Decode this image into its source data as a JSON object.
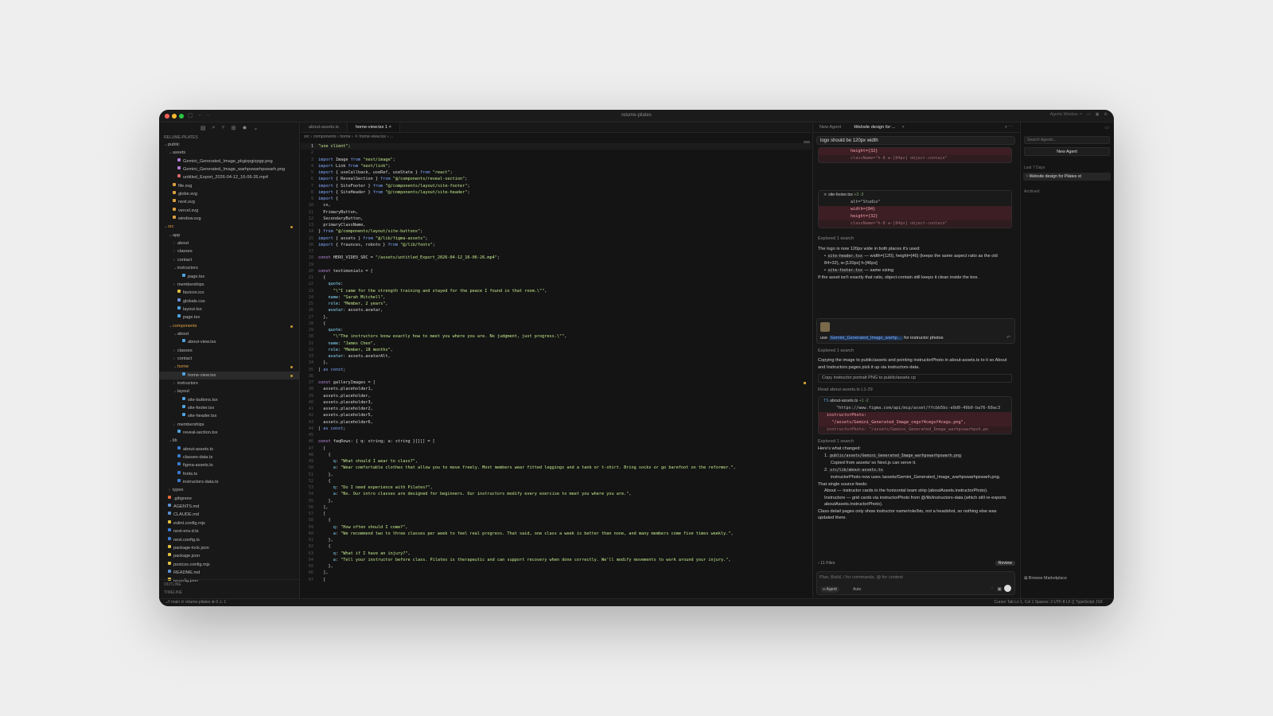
{
  "window": {
    "title": "relume-pilates",
    "agents_window": "Agents Window ↗"
  },
  "sidebar": {
    "header": "RELUME-PILATES",
    "outline": "OUTLINE",
    "timeline": "TIMELINE",
    "tree": [
      {
        "label": "public",
        "d": 0,
        "t": "f"
      },
      {
        "label": "assets",
        "d": 1,
        "t": "f"
      },
      {
        "label": "Gemini_Generated_Image_pkgizpgizpgp.png",
        "d": 2,
        "t": "img"
      },
      {
        "label": "Gemini_Generated_Image_warhpswarhpswarh.png",
        "d": 2,
        "t": "img"
      },
      {
        "label": "untitled_Export_2026-04-12_16-06-26.mp4",
        "d": 2,
        "t": "vid"
      },
      {
        "label": "file.svg",
        "d": 1,
        "t": "svg"
      },
      {
        "label": "globe.svg",
        "d": 1,
        "t": "svg"
      },
      {
        "label": "next.svg",
        "d": 1,
        "t": "svg"
      },
      {
        "label": "vercel.svg",
        "d": 1,
        "t": "svg"
      },
      {
        "label": "window.svg",
        "d": 1,
        "t": "svg"
      },
      {
        "label": "src",
        "d": 0,
        "t": "f",
        "m": 1,
        "c": "#e0a040"
      },
      {
        "label": "app",
        "d": 1,
        "t": "f"
      },
      {
        "label": "about",
        "d": 2,
        "t": "fc"
      },
      {
        "label": "classes",
        "d": 2,
        "t": "fc"
      },
      {
        "label": "contact",
        "d": 2,
        "t": "fc"
      },
      {
        "label": "instructors",
        "d": 2,
        "t": "f"
      },
      {
        "label": "page.tsx",
        "d": 3,
        "t": "tsx"
      },
      {
        "label": "memberships",
        "d": 2,
        "t": "fc"
      },
      {
        "label": "favicon.ico",
        "d": 2,
        "t": "ico"
      },
      {
        "label": "globals.css",
        "d": 2,
        "t": "css"
      },
      {
        "label": "layout.tsx",
        "d": 2,
        "t": "tsx"
      },
      {
        "label": "page.tsx",
        "d": 2,
        "t": "tsx"
      },
      {
        "label": "components",
        "d": 1,
        "t": "f",
        "m": 1,
        "c": "#e0a040"
      },
      {
        "label": "about",
        "d": 2,
        "t": "f"
      },
      {
        "label": "about-view.tsx",
        "d": 3,
        "t": "tsx"
      },
      {
        "label": "classes",
        "d": 2,
        "t": "fc"
      },
      {
        "label": "contact",
        "d": 2,
        "t": "fc"
      },
      {
        "label": "home",
        "d": 2,
        "t": "f",
        "m": 1,
        "c": "#e0a040"
      },
      {
        "label": "home-view.tsx",
        "d": 3,
        "t": "tsx",
        "a": 1,
        "m": 1
      },
      {
        "label": "instructors",
        "d": 2,
        "t": "fc"
      },
      {
        "label": "layout",
        "d": 2,
        "t": "f"
      },
      {
        "label": "site-buttons.tsx",
        "d": 3,
        "t": "tsx"
      },
      {
        "label": "site-footer.tsx",
        "d": 3,
        "t": "tsx"
      },
      {
        "label": "site-header.tsx",
        "d": 3,
        "t": "tsx"
      },
      {
        "label": "memberships",
        "d": 2,
        "t": "fc"
      },
      {
        "label": "reveal-section.tsx",
        "d": 2,
        "t": "tsx"
      },
      {
        "label": "lib",
        "d": 1,
        "t": "f"
      },
      {
        "label": "about-assets.ts",
        "d": 2,
        "t": "ts"
      },
      {
        "label": "classes-data.ts",
        "d": 2,
        "t": "ts"
      },
      {
        "label": "figma-assets.ts",
        "d": 2,
        "t": "ts"
      },
      {
        "label": "fonts.ts",
        "d": 2,
        "t": "ts"
      },
      {
        "label": "instructors-data.ts",
        "d": 2,
        "t": "ts"
      },
      {
        "label": "types",
        "d": 1,
        "t": "fc"
      },
      {
        "label": ".gitignore",
        "d": 0,
        "t": "git"
      },
      {
        "label": "AGENTS.md",
        "d": 0,
        "t": "md"
      },
      {
        "label": "CLAUDE.md",
        "d": 0,
        "t": "md"
      },
      {
        "label": "eslint.config.mjs",
        "d": 0,
        "t": "js"
      },
      {
        "label": "next-env.d.ts",
        "d": 0,
        "t": "ts"
      },
      {
        "label": "next.config.ts",
        "d": 0,
        "t": "ts"
      },
      {
        "label": "package-lock.json",
        "d": 0,
        "t": "json"
      },
      {
        "label": "package.json",
        "d": 0,
        "t": "json"
      },
      {
        "label": "postcss.config.mjs",
        "d": 0,
        "t": "js"
      },
      {
        "label": "README.md",
        "d": 0,
        "t": "md"
      },
      {
        "label": "tsconfig.json",
        "d": 0,
        "t": "json"
      }
    ]
  },
  "editor": {
    "tabs": [
      {
        "label": "about-assets.ts",
        "on": 0
      },
      {
        "label": "home-view.tsx 1  ×",
        "on": 1
      }
    ],
    "breadcrumb": "src › components › home › ⚛ home-view.tsx › ..."
  },
  "code": [
    [
      [
        "s",
        "\"use client\";"
      ]
    ],
    [],
    [
      [
        "k",
        "import "
      ],
      [
        "v",
        "Image "
      ],
      [
        "k",
        "from "
      ],
      [
        "s",
        "\"next/image\""
      ],
      [
        "v",
        ";"
      ]
    ],
    [
      [
        "k",
        "import "
      ],
      [
        "v",
        "Link "
      ],
      [
        "k",
        "from "
      ],
      [
        "s",
        "\"next/link\""
      ],
      [
        "v",
        ";"
      ]
    ],
    [
      [
        "k",
        "import "
      ],
      [
        "v",
        "{ useCallback, useRef, useState } "
      ],
      [
        "k",
        "from "
      ],
      [
        "s",
        "\"react\""
      ],
      [
        "v",
        ";"
      ]
    ],
    [
      [
        "k",
        "import "
      ],
      [
        "v",
        "{ RevealSection } "
      ],
      [
        "k",
        "from "
      ],
      [
        "s",
        "\"@/components/reveal-section\""
      ],
      [
        "v",
        ";"
      ]
    ],
    [
      [
        "k",
        "import "
      ],
      [
        "v",
        "{ SiteFooter } "
      ],
      [
        "k",
        "from "
      ],
      [
        "s",
        "\"@/components/layout/site-footer\""
      ],
      [
        "v",
        ";"
      ]
    ],
    [
      [
        "k",
        "import "
      ],
      [
        "v",
        "{ SiteHeader } "
      ],
      [
        "k",
        "from "
      ],
      [
        "s",
        "\"@/components/layout/site-header\""
      ],
      [
        "v",
        ";"
      ]
    ],
    [
      [
        "k",
        "import "
      ],
      [
        "v",
        "{"
      ]
    ],
    [
      [
        "v",
        "  cx,"
      ]
    ],
    [
      [
        "v",
        "  PrimaryButton,"
      ]
    ],
    [
      [
        "v",
        "  SecondaryButton,"
      ]
    ],
    [
      [
        "v",
        "  primaryClassName,"
      ]
    ],
    [
      [
        "v",
        "} "
      ],
      [
        "k",
        "from "
      ],
      [
        "s",
        "\"@/components/layout/site-buttons\""
      ],
      [
        "v",
        ";"
      ]
    ],
    [
      [
        "k",
        "import "
      ],
      [
        "v",
        "{ assets } "
      ],
      [
        "k",
        "from "
      ],
      [
        "s",
        "\"@/lib/figma-assets\""
      ],
      [
        "v",
        ";"
      ]
    ],
    [
      [
        "k",
        "import "
      ],
      [
        "v",
        "{ fraunces, roboto } "
      ],
      [
        "k",
        "from "
      ],
      [
        "s",
        "\"@/lib/fonts\""
      ],
      [
        "v",
        ";"
      ]
    ],
    [],
    [
      [
        "p",
        "const "
      ],
      [
        "v",
        "HERO_VIDEO_SRC = "
      ],
      [
        "s",
        "\"/assets/untitled_Export_2026-04-12_16-06-26.mp4\""
      ],
      [
        "v",
        ";"
      ]
    ],
    [],
    [
      [
        "p",
        "const "
      ],
      [
        "v",
        "testimonials = ["
      ]
    ],
    [
      [
        "v",
        "  {"
      ]
    ],
    [
      [
        "c",
        "    quote"
      ],
      [
        "v",
        ":"
      ]
    ],
    [
      [
        "s",
        "      \"\\\"I came for the strength training and stayed for the peace I found in that room.\\\"\""
      ],
      [
        "v",
        ","
      ]
    ],
    [
      [
        "c",
        "    name"
      ],
      [
        "v",
        ": "
      ],
      [
        "s",
        "\"Sarah Mitchell\""
      ],
      [
        "v",
        ","
      ]
    ],
    [
      [
        "c",
        "    role"
      ],
      [
        "v",
        ": "
      ],
      [
        "s",
        "\"Member, 2 years\""
      ],
      [
        "v",
        ","
      ]
    ],
    [
      [
        "c",
        "    avatar"
      ],
      [
        "v",
        ": assets.avatar,"
      ]
    ],
    [
      [
        "v",
        "  },"
      ]
    ],
    [
      [
        "v",
        "  {"
      ]
    ],
    [
      [
        "c",
        "    quote"
      ],
      [
        "v",
        ":"
      ]
    ],
    [
      [
        "s",
        "      \"\\\"The instructors know exactly how to meet you where you are. No judgment, just progress.\\\"\""
      ],
      [
        "v",
        ","
      ]
    ],
    [
      [
        "c",
        "    name"
      ],
      [
        "v",
        ": "
      ],
      [
        "s",
        "\"James Chen\""
      ],
      [
        "v",
        ","
      ]
    ],
    [
      [
        "c",
        "    role"
      ],
      [
        "v",
        ": "
      ],
      [
        "s",
        "\"Member, 18 months\""
      ],
      [
        "v",
        ","
      ]
    ],
    [
      [
        "c",
        "    avatar"
      ],
      [
        "v",
        ": assets.avatarAlt,"
      ]
    ],
    [
      [
        "v",
        "  },"
      ]
    ],
    [
      [
        "v",
        "] "
      ],
      [
        "k",
        "as const"
      ],
      [
        "v",
        ";"
      ]
    ],
    [],
    [
      [
        "p",
        "const "
      ],
      [
        "v",
        "galleryImages = ["
      ]
    ],
    [
      [
        "v",
        "  assets.placeholder1,"
      ]
    ],
    [
      [
        "v",
        "  assets.placeholder,"
      ]
    ],
    [
      [
        "v",
        "  assets.placeholder3,"
      ]
    ],
    [
      [
        "v",
        "  assets.placeholder2,"
      ]
    ],
    [
      [
        "v",
        "  assets.placeholder5,"
      ]
    ],
    [
      [
        "v",
        "  assets.placeholder6,"
      ]
    ],
    [
      [
        "v",
        "] "
      ],
      [
        "k",
        "as const"
      ],
      [
        "v",
        ";"
      ]
    ],
    [],
    [
      [
        "p",
        "const "
      ],
      [
        "v",
        "faqRows: { q: string; a: string }[][] = ["
      ]
    ],
    [
      [
        "v",
        "  ["
      ]
    ],
    [
      [
        "v",
        "    {"
      ]
    ],
    [
      [
        "c",
        "      q"
      ],
      [
        "v",
        ": "
      ],
      [
        "s",
        "\"What should I wear to class?\""
      ],
      [
        "v",
        ","
      ]
    ],
    [
      [
        "c",
        "      a"
      ],
      [
        "v",
        ": "
      ],
      [
        "s",
        "\"Wear comfortable clothes that allow you to move freely. Most members wear fitted leggings and a tank or t-shirt. Bring socks or go barefoot on the reformer.\""
      ],
      [
        "v",
        ","
      ]
    ],
    [
      [
        "v",
        "    },"
      ]
    ],
    [
      [
        "v",
        "    {"
      ]
    ],
    [
      [
        "c",
        "      q"
      ],
      [
        "v",
        ": "
      ],
      [
        "s",
        "\"Do I need experience with Pilates?\""
      ],
      [
        "v",
        ","
      ]
    ],
    [
      [
        "c",
        "      a"
      ],
      [
        "v",
        ": "
      ],
      [
        "s",
        "\"No. Our intro classes are designed for beginners. Our instructors modify every exercise to meet you where you are.\""
      ],
      [
        "v",
        ","
      ]
    ],
    [
      [
        "v",
        "    },"
      ]
    ],
    [
      [
        "v",
        "  ],"
      ]
    ],
    [
      [
        "v",
        "  ["
      ]
    ],
    [
      [
        "v",
        "    {"
      ]
    ],
    [
      [
        "c",
        "      q"
      ],
      [
        "v",
        ": "
      ],
      [
        "s",
        "\"How often should I come?\""
      ],
      [
        "v",
        ","
      ]
    ],
    [
      [
        "c",
        "      a"
      ],
      [
        "v",
        ": "
      ],
      [
        "s",
        "\"We recommend two to three classes per week to feel real progress. That said, one class a week is better than none, and many members come five times weekly.\""
      ],
      [
        "v",
        ","
      ]
    ],
    [
      [
        "v",
        "    },"
      ]
    ],
    [
      [
        "v",
        "    {"
      ]
    ],
    [
      [
        "c",
        "      q"
      ],
      [
        "v",
        ": "
      ],
      [
        "s",
        "\"What if I have an injury?\""
      ],
      [
        "v",
        ","
      ]
    ],
    [
      [
        "c",
        "      a"
      ],
      [
        "v",
        ": "
      ],
      [
        "s",
        "\"Tell your instructor before class. Pilates is therapeutic and can support recovery when done correctly. We'll modify movements to work around your injury.\""
      ],
      [
        "v",
        ","
      ]
    ],
    [
      [
        "v",
        "    },"
      ]
    ],
    [
      [
        "v",
        "  ],"
      ]
    ],
    [
      [
        "v",
        "  ["
      ]
    ]
  ],
  "agent": {
    "tabs": [
      "New Agent",
      "Website design for ..."
    ],
    "query": "logo should be 120px width",
    "diff1": [
      "height={32}",
      "className=\"h-8 w-[84px] object-contain\""
    ],
    "footer_file": "site-footer.tsx",
    "footer_delta": "+3 -3",
    "diff2": [
      "alt=\"Studio\"",
      "width={84}",
      "height={32}",
      "className=\"h-8 w-[84px] object-contain\""
    ],
    "explored": "Explored 1 search",
    "msg1": "The logo is now 120px wide in both places it's used:",
    "msg1_b1a": "site-header.tsx",
    "msg1_b1b": " — width={120}, height={46} (keeps the same aspect ratio as the old 84×32), w-[120px] h-[46px]",
    "msg1_b2a": "site-footer.tsx",
    "msg1_b2b": " — same sizing",
    "msg1_end": "If the asset isn't exactly that ratio, object-contain still keeps it clean inside the box.",
    "user_use": "use",
    "user_chip": "Gemini_Generated_Image_warhp...",
    "user_rest": "for instructor photos",
    "msg2": "Copying the image to public/assets and pointing instructorPhoto in about-assets.ts to it so About and Instructors pages pick it up via instructors-data.",
    "cmd": "Copy instructor portrait PNG to public/assets  cp",
    "read": "Read about-assets.ts L1-29",
    "assets_file": "about-assets.ts",
    "assets_delta": "+1 -2",
    "diff3": [
      "\"https://www.figma.com/api/mcp/asset/ffcbb5bc-e9d0-49b0-ba76-60ac3",
      "instructorPhoto:",
      "  \"/assets/Gemini_Generated_Image_cegsf4cegsf4cegs.png\",",
      "instructorPhoto: \"/assets/Gemini_Generated_Image_warhpswarhpsh.pn"
    ],
    "changed": "Here's what changed:",
    "c1": "public/assets/Gemini_Generated_Image_warhpswarhpswarh.png",
    "c1s": "Copied from assets/ so Next.js can serve it.",
    "c2": "src/lib/about-assets.ts",
    "c2s": "instructorPhoto now uses /assets/Gemini_Generated_Image_warhpswarhpswarh.png.",
    "feeds": "That single source feeds:",
    "f1": "About — instructor cards in the horizontal team strip (aboutAssets.instructorPhoto).",
    "f2": "Instructors — grid cards via instructorPhoto from @/lib/instructors-data (which still re-exports aboutAssets.instructorPhoto).",
    "closing": "Class detail pages only show instructor name/role/bio, not a headshot, so nothing else was updated there.",
    "files": "› 11 Files",
    "review": "Review",
    "placeholder": "Plan, Build, / for commands, @ for context",
    "mode": "∞ Agent",
    "auto": "Auto"
  },
  "right": {
    "search": "Search Agents...",
    "new": "New Agent",
    "last7": "Last 7 Days",
    "item": "Website design for Pilates st",
    "archived": "Archived",
    "marketplace": "Browse Marketplace"
  },
  "status": {
    "left": "⎇ main  ⟳   relume-pilates   ⊗ 0 ⚠ 1",
    "right": "Cursor Tab    Ln 1, Col 1    Spaces: 2    UTF-8    LF    {}  TypeScript JSX"
  }
}
